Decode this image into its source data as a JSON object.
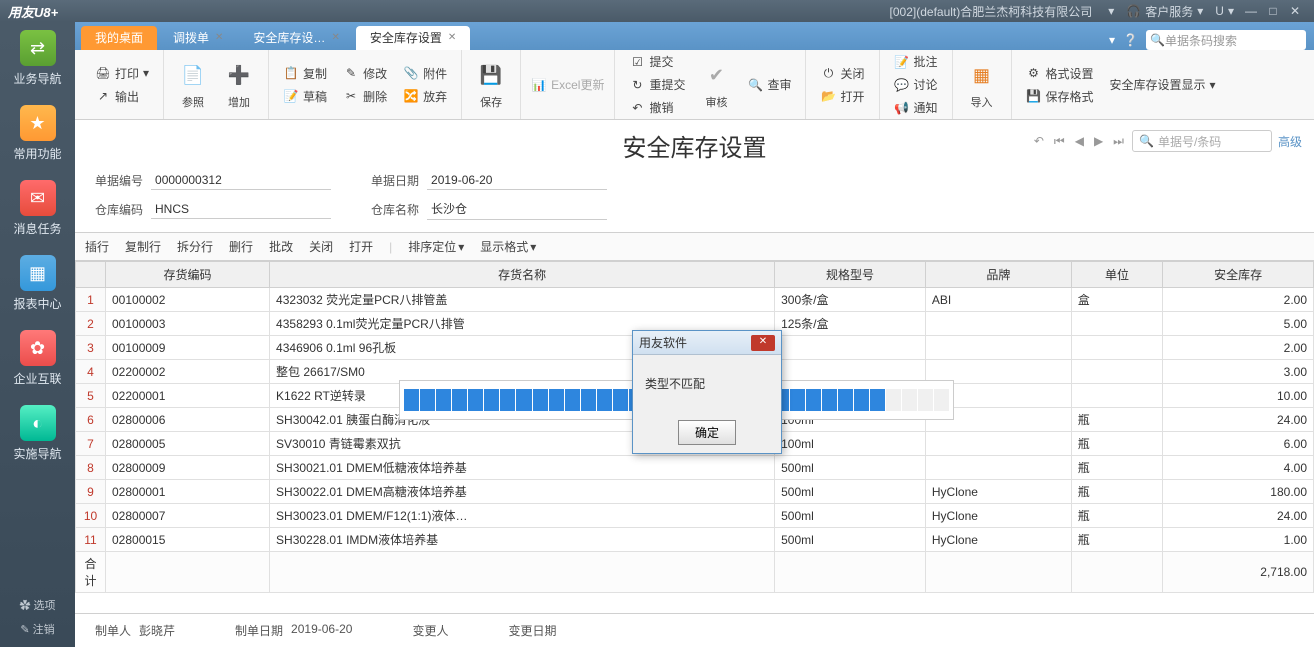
{
  "titlebar": {
    "brand": "用友U8+",
    "company": "[002](default)合肥兰杰柯科技有限公司",
    "service": "客户服务",
    "u": "U"
  },
  "leftnav": {
    "items": [
      {
        "label": "业务导航",
        "cls": "ico-green",
        "glyph": "⇄"
      },
      {
        "label": "常用功能",
        "cls": "ico-orange",
        "glyph": "★"
      },
      {
        "label": "消息任务",
        "cls": "ico-red",
        "glyph": "✉"
      },
      {
        "label": "报表中心",
        "cls": "ico-blue",
        "glyph": "▦"
      },
      {
        "label": "企业互联",
        "cls": "ico-pink",
        "glyph": "✿"
      },
      {
        "label": "实施导航",
        "cls": "ico-teal",
        "glyph": "◐"
      }
    ],
    "options": "✿ 选项",
    "notes": "✎ 注销"
  },
  "tabs": {
    "home": "我的桌面",
    "items": [
      {
        "label": "调拨单"
      },
      {
        "label": "安全库存设…"
      },
      {
        "label": "安全库存设置",
        "active": true
      }
    ],
    "search_placeholder": "单据条码搜索"
  },
  "ribbon": {
    "print": "打印",
    "output": "输出",
    "ref": "参照",
    "add": "增加",
    "copy": "复制",
    "edit": "修改",
    "attach": "附件",
    "draft": "草稿",
    "delete": "删除",
    "discard": "放弃",
    "save": "保存",
    "excel": "Excel更新",
    "submit": "提交",
    "resubmit": "重提交",
    "revoke": "撤销",
    "audit": "审核",
    "review": "查审",
    "close": "关闭",
    "open": "打开",
    "note": "批注",
    "discuss": "讨论",
    "notify": "通知",
    "import": "导入",
    "fmtset": "格式设置",
    "dispset": "安全库存设置显示",
    "savefmt": "保存格式"
  },
  "dochdr": {
    "title": "安全库存设置",
    "search_placeholder": "单据号/条码",
    "adv": "高级",
    "billno_label": "单据编号",
    "billno": "0000000312",
    "billdate_label": "单据日期",
    "billdate": "2019-06-20",
    "whcode_label": "仓库编码",
    "whcode": "HNCS",
    "whname_label": "仓库名称",
    "whname": "长沙仓"
  },
  "subtool": {
    "ins": "插行",
    "copyr": "复制行",
    "split": "拆分行",
    "del": "删行",
    "batch": "批改",
    "close": "关闭",
    "open": "打开",
    "sort": "排序定位",
    "disp": "显示格式"
  },
  "grid": {
    "cols": [
      "存货编码",
      "存货名称",
      "规格型号",
      "品牌",
      "单位",
      "安全库存"
    ],
    "rows": [
      {
        "n": "1",
        "code": "00100002",
        "name": "4323032 荧光定量PCR八排管盖",
        "spec": "300条/盒",
        "brand": "ABI",
        "unit": "盒",
        "qty": "2.00"
      },
      {
        "n": "2",
        "code": "00100003",
        "name": "4358293 0.1ml荧光定量PCR八排管",
        "spec": "125条/盒",
        "brand": "",
        "unit": "",
        "qty": "5.00"
      },
      {
        "n": "3",
        "code": "00100009",
        "name": "4346906 0.1ml 96孔板",
        "spec": "",
        "brand": "",
        "unit": "",
        "qty": "2.00"
      },
      {
        "n": "4",
        "code": "02200002",
        "name": "整包 26617/SM0",
        "spec": "",
        "brand": "",
        "unit": "",
        "qty": "3.00"
      },
      {
        "n": "5",
        "code": "02200001",
        "name": "K1622 RT逆转录",
        "spec": "",
        "brand": "",
        "unit": "",
        "qty": "10.00"
      },
      {
        "n": "6",
        "code": "02800006",
        "name": "SH30042.01 胰蛋白酶消化液",
        "spec": "100ml",
        "brand": "",
        "unit": "瓶",
        "qty": "24.00"
      },
      {
        "n": "7",
        "code": "02800005",
        "name": "SV30010 青链霉素双抗",
        "spec": "100ml",
        "brand": "",
        "unit": "瓶",
        "qty": "6.00"
      },
      {
        "n": "8",
        "code": "02800009",
        "name": "SH30021.01 DMEM低糖液体培养基",
        "spec": "500ml",
        "brand": "",
        "unit": "瓶",
        "qty": "4.00"
      },
      {
        "n": "9",
        "code": "02800001",
        "name": "SH30022.01 DMEM高糖液体培养基",
        "spec": "500ml",
        "brand": "HyClone",
        "unit": "瓶",
        "qty": "180.00"
      },
      {
        "n": "10",
        "code": "02800007",
        "name": "SH30023.01 DMEM/F12(1:1)液体…",
        "spec": "500ml",
        "brand": "HyClone",
        "unit": "瓶",
        "qty": "24.00"
      },
      {
        "n": "11",
        "code": "02800015",
        "name": "SH30228.01 IMDM液体培养基",
        "spec": "500ml",
        "brand": "HyClone",
        "unit": "瓶",
        "qty": "1.00"
      }
    ],
    "total_label": "合计",
    "total": "2,718.00"
  },
  "docftr": {
    "maker_label": "制单人",
    "maker": "彭晓芹",
    "makedate_label": "制单日期",
    "makedate": "2019-06-20",
    "changer_label": "变更人",
    "changedate_label": "变更日期"
  },
  "dialog": {
    "title": "用友软件",
    "msg": "类型不匹配",
    "ok": "确定"
  }
}
